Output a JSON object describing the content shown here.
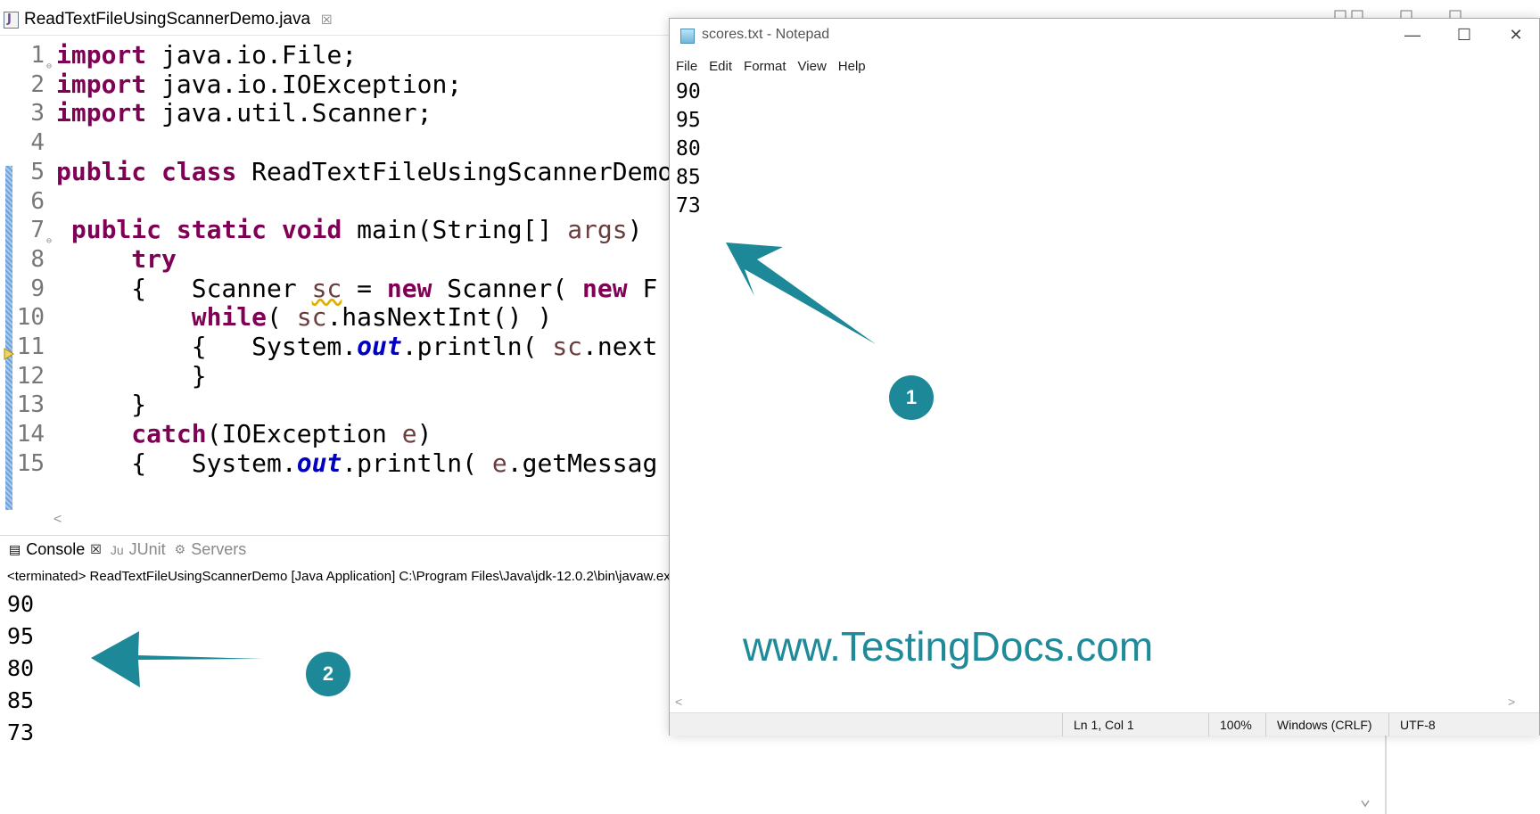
{
  "editor": {
    "tab_label": "ReadTextFileUsingScannerDemo.java",
    "tab_close": "☒",
    "hscroll_left": "<"
  },
  "code_lines": [
    {
      "num": "1",
      "parts": [
        [
          "kw",
          "import"
        ],
        [
          "",
          " java.io.File;"
        ]
      ]
    },
    {
      "num": "2",
      "parts": [
        [
          "kw",
          "import"
        ],
        [
          "",
          " java.io.IOException;"
        ]
      ]
    },
    {
      "num": "3",
      "parts": [
        [
          "kw",
          "import"
        ],
        [
          "",
          " java.util.Scanner;"
        ]
      ]
    },
    {
      "num": "4",
      "parts": []
    },
    {
      "num": "5",
      "parts": [
        [
          "kw",
          "public"
        ],
        [
          "",
          " "
        ],
        [
          "kw",
          "class"
        ],
        [
          "",
          " ReadTextFileUsingScannerDemo "
        ],
        [
          "brace",
          "{"
        ]
      ]
    },
    {
      "num": "6",
      "parts": []
    },
    {
      "num": "7",
      "parts": [
        [
          "",
          " "
        ],
        [
          "kw",
          "public"
        ],
        [
          "",
          " "
        ],
        [
          "kw",
          "static"
        ],
        [
          "",
          " "
        ],
        [
          "kw",
          "void"
        ],
        [
          "",
          " main(String[] "
        ],
        [
          "local",
          "args"
        ],
        [
          "",
          ")"
        ]
      ]
    },
    {
      "num": "8",
      "parts": [
        [
          "",
          "     "
        ],
        [
          "kw",
          "try"
        ]
      ]
    },
    {
      "num": "9",
      "parts": [
        [
          "",
          "     {   Scanner "
        ],
        [
          "warnlocal",
          "sc"
        ],
        [
          "",
          " = "
        ],
        [
          "kw",
          "new"
        ],
        [
          "",
          " Scanner( "
        ],
        [
          "kw",
          "new"
        ],
        [
          "",
          " F"
        ]
      ]
    },
    {
      "num": "10",
      "parts": [
        [
          "",
          "         "
        ],
        [
          "kw",
          "while"
        ],
        [
          "",
          "( "
        ],
        [
          "local",
          "sc"
        ],
        [
          "",
          ".hasNextInt() )"
        ]
      ]
    },
    {
      "num": "11",
      "parts": [
        [
          "",
          "         {   System."
        ],
        [
          "static",
          "out"
        ],
        [
          "",
          ".println( "
        ],
        [
          "local",
          "sc"
        ],
        [
          "",
          ".next"
        ]
      ]
    },
    {
      "num": "12",
      "parts": [
        [
          "",
          "         }"
        ]
      ]
    },
    {
      "num": "13",
      "parts": [
        [
          "",
          "     }"
        ]
      ]
    },
    {
      "num": "14",
      "parts": [
        [
          "",
          "     "
        ],
        [
          "kw",
          "catch"
        ],
        [
          "",
          "(IOException "
        ],
        [
          "local",
          "e"
        ],
        [
          "",
          ")"
        ]
      ]
    },
    {
      "num": "15",
      "parts": [
        [
          "",
          "     {   System."
        ],
        [
          "static",
          "out"
        ],
        [
          "",
          ".println( "
        ],
        [
          "local",
          "e"
        ],
        [
          "",
          ".getMessag"
        ]
      ]
    }
  ],
  "console": {
    "tabs": [
      {
        "label": "Console",
        "icon": "▤",
        "close": "☒",
        "active": true
      },
      {
        "label": "JUnit",
        "icon": "Ju",
        "active": false
      },
      {
        "label": "Servers",
        "icon": "⚙",
        "active": false
      }
    ],
    "status_line": "<terminated> ReadTextFileUsingScannerDemo [Java Application] C:\\Program Files\\Java\\jdk-12.0.2\\bin\\javaw.exe",
    "output": [
      "90",
      "95",
      "80",
      "85",
      "73"
    ]
  },
  "notepad": {
    "title": "scores.txt - Notepad",
    "window_buttons": {
      "minimize": "—",
      "maximize": "☐",
      "close": "✕"
    },
    "menu": [
      "File",
      "Edit",
      "Format",
      "View",
      "Help"
    ],
    "lines": [
      "90",
      "95",
      "80",
      "85",
      "73"
    ],
    "status": {
      "position": "Ln 1, Col 1",
      "zoom": "100%",
      "line_endings": "Windows (CRLF)",
      "encoding": "UTF-8"
    },
    "hscroll_left": "<",
    "hscroll_right": ">"
  },
  "annotations": {
    "watermark": "www.TestingDocs.com",
    "callout_1": "1",
    "callout_2": "2",
    "color": "#1d8898"
  }
}
